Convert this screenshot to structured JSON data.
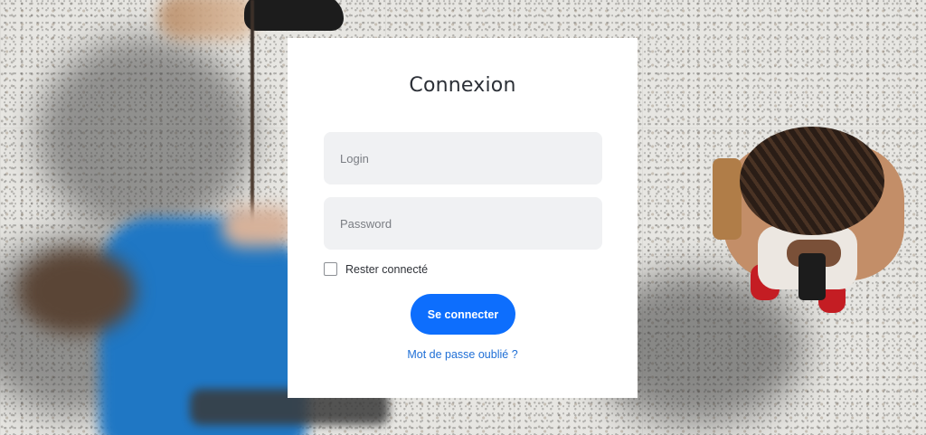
{
  "background": {
    "image_description_name": "overhead-street-crowd-photo"
  },
  "login_card": {
    "title": "Connexion",
    "login_placeholder": "Login",
    "login_value": "",
    "password_placeholder": "Password",
    "password_value": "",
    "remember_label": "Rester connecté",
    "remember_checked": false,
    "submit_label": "Se connecter",
    "forgot_label": "Mot de passe oublié ?"
  },
  "colors": {
    "primary": "#0d6efd",
    "link": "#1f6fd6",
    "card_background": "#ffffff",
    "field_background": "#f0f1f3"
  }
}
